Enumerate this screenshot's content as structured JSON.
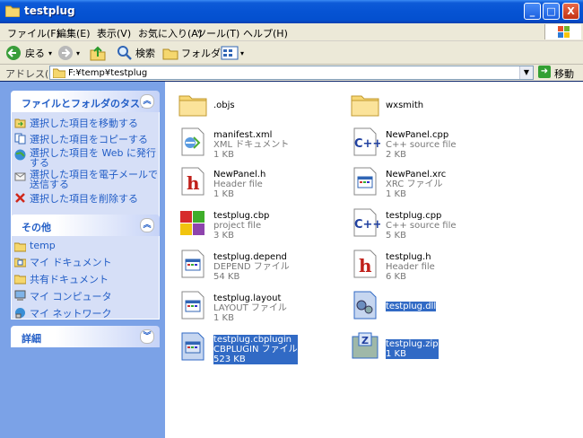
{
  "window": {
    "title": "testplug"
  },
  "title_buttons": {
    "min": "_",
    "max": "□",
    "close": "X"
  },
  "menu": [
    "ファイル(F)",
    "編集(E)",
    "表示(V)",
    "お気に入り(A)",
    "ツール(T)",
    "ヘルプ(H)"
  ],
  "toolbar": {
    "back": "戻る",
    "search": "検索",
    "folders": "フォルダ"
  },
  "address": {
    "label": "アドレス(D)",
    "value": "F:¥temp¥testplug",
    "go": "移動"
  },
  "tasks_panel": {
    "title": "ファイルとフォルダのタスク",
    "items": [
      "選択した項目を移動する",
      "選択した項目をコピーする",
      "選択した項目を Web に発行する",
      "選択した項目を電子メールで送信する",
      "選択した項目を削除する"
    ]
  },
  "other_panel": {
    "title": "その他",
    "items": [
      "temp",
      "マイ ドキュメント",
      "共有ドキュメント",
      "マイ コンピュータ",
      "マイ ネットワーク"
    ]
  },
  "details_panel": {
    "title": "詳細"
  },
  "files": [
    {
      "name": ".objs",
      "type": "",
      "size": "",
      "icon": "folder"
    },
    {
      "name": "wxsmith",
      "type": "",
      "size": "",
      "icon": "folder"
    },
    {
      "name": "manifest.xml",
      "type": "XML ドキュメント",
      "size": "1 KB",
      "icon": "xml"
    },
    {
      "name": "NewPanel.cpp",
      "type": "C++ source file",
      "size": "2 KB",
      "icon": "cpp"
    },
    {
      "name": "NewPanel.h",
      "type": "Header file",
      "size": "1 KB",
      "icon": "h"
    },
    {
      "name": "NewPanel.xrc",
      "type": "XRC ファイル",
      "size": "1 KB",
      "icon": "generic"
    },
    {
      "name": "testplug.cbp",
      "type": "project file",
      "size": "3 KB",
      "icon": "cbp"
    },
    {
      "name": "testplug.cpp",
      "type": "C++ source file",
      "size": "5 KB",
      "icon": "cpp"
    },
    {
      "name": "testplug.depend",
      "type": "DEPEND ファイル",
      "size": "54 KB",
      "icon": "generic"
    },
    {
      "name": "testplug.h",
      "type": "Header file",
      "size": "6 KB",
      "icon": "h"
    },
    {
      "name": "testplug.layout",
      "type": "LAYOUT ファイル",
      "size": "1 KB",
      "icon": "generic"
    },
    {
      "name": "testplug.dll",
      "type": "",
      "size": "",
      "icon": "dll"
    },
    {
      "name": "testplug.cbplugin",
      "type": "CBPLUGIN ファイル",
      "size": "523 KB",
      "icon": "generic"
    },
    {
      "name": "testplug.zip",
      "type": "1 KB",
      "size": "",
      "icon": "zip"
    }
  ]
}
